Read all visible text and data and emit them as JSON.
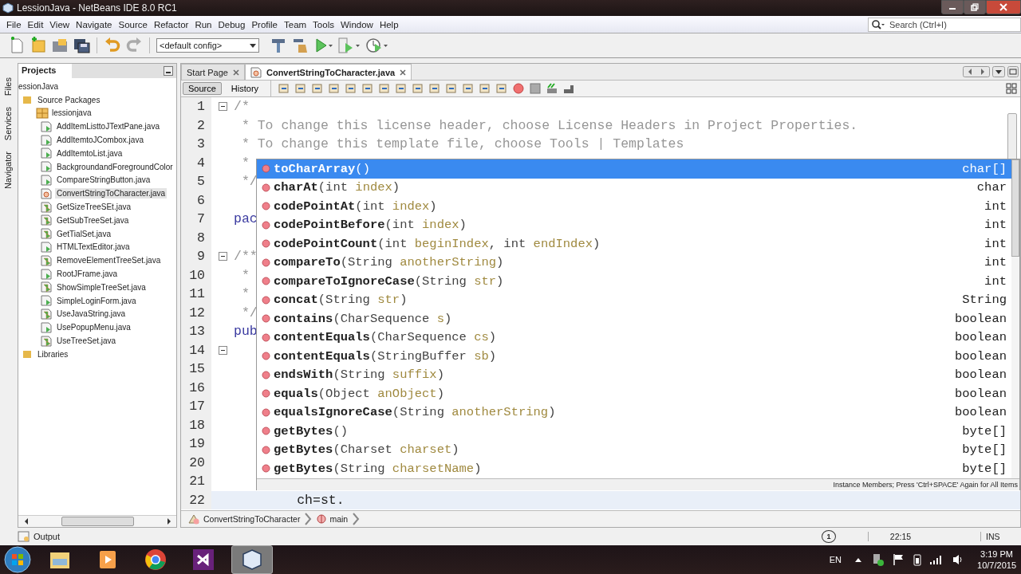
{
  "window": {
    "title": "LessionJava - NetBeans IDE 8.0 RC1"
  },
  "menu": [
    "File",
    "Edit",
    "View",
    "Navigate",
    "Source",
    "Refactor",
    "Run",
    "Debug",
    "Profile",
    "Team",
    "Tools",
    "Window",
    "Help"
  ],
  "toolbar": {
    "config": "<default config>"
  },
  "search": {
    "placeholder": "Search (Ctrl+I)"
  },
  "side_tabs": [
    "Files",
    "Services",
    "Navigator"
  ],
  "projects": {
    "title": "Projects",
    "tree": [
      {
        "label": "essionJava",
        "children": [
          {
            "label": "Source Packages",
            "kind": "folder",
            "children": [
              {
                "label": "lessionjava",
                "kind": "package",
                "children": [
                  {
                    "label": "AddItemListtoJTextPane.java",
                    "kind": "form",
                    "selected": false
                  },
                  {
                    "label": "AddItemtoJCombox.java",
                    "kind": "form",
                    "selected": false
                  },
                  {
                    "label": "AddItemtoList.java",
                    "kind": "form",
                    "selected": false
                  },
                  {
                    "label": "BackgroundandForegroundColor",
                    "kind": "form",
                    "selected": false
                  },
                  {
                    "label": "CompareStringButton.java",
                    "kind": "form",
                    "selected": false
                  },
                  {
                    "label": "ConvertStringToCharacter.java",
                    "kind": "class",
                    "selected": true
                  },
                  {
                    "label": "GetSizeTreeSEt.java",
                    "kind": "main",
                    "selected": false
                  },
                  {
                    "label": "GetSubTreeSet.java",
                    "kind": "main",
                    "selected": false
                  },
                  {
                    "label": "GetTialSet.java",
                    "kind": "main",
                    "selected": false
                  },
                  {
                    "label": "HTMLTextEditor.java",
                    "kind": "form",
                    "selected": false
                  },
                  {
                    "label": "RemoveElementTreeSet.java",
                    "kind": "main",
                    "selected": false
                  },
                  {
                    "label": "RootJFrame.java",
                    "kind": "form",
                    "selected": false
                  },
                  {
                    "label": "ShowSimpleTreeSet.java",
                    "kind": "main",
                    "selected": false
                  },
                  {
                    "label": "SimpleLoginForm.java",
                    "kind": "form",
                    "selected": false
                  },
                  {
                    "label": "UseJavaString.java",
                    "kind": "main",
                    "selected": false
                  },
                  {
                    "label": "UsePopupMenu.java",
                    "kind": "form",
                    "selected": false
                  },
                  {
                    "label": "UseTreeSet.java",
                    "kind": "main",
                    "selected": false
                  }
                ]
              }
            ]
          },
          {
            "label": "Libraries",
            "kind": "folder"
          }
        ]
      }
    ]
  },
  "editor_tabs": [
    {
      "label": "Start Page",
      "selected": false
    },
    {
      "label": "ConvertStringToCharacter.java",
      "selected": true
    }
  ],
  "views": [
    {
      "label": "Source",
      "selected": true
    },
    {
      "label": "History",
      "selected": false
    }
  ],
  "code": [
    {
      "number": "1",
      "text": "/*",
      "kind": "comment",
      "fold": true,
      "current": false
    },
    {
      "number": "2",
      "text": " * To change this license header, choose License Headers in Project Properties.",
      "kind": "comment",
      "fold": false,
      "current": false
    },
    {
      "number": "3",
      "text": " * To change this template file, choose Tools | Templates",
      "kind": "comment",
      "fold": false,
      "current": false
    },
    {
      "number": "4",
      "text": " *",
      "kind": "comment",
      "fold": false,
      "current": false
    },
    {
      "number": "5",
      "text": " */",
      "kind": "comment",
      "fold": false,
      "current": false
    },
    {
      "number": "6",
      "fold": false,
      "current": false
    },
    {
      "number": "7",
      "text": "pac",
      "kind": "keyword",
      "fold": false,
      "current": false
    },
    {
      "number": "8",
      "fold": false,
      "current": false
    },
    {
      "number": "9",
      "text": "/**",
      "kind": "comment",
      "fold": true,
      "current": false
    },
    {
      "number": "10",
      "text": " *",
      "kind": "comment",
      "fold": false,
      "current": false
    },
    {
      "number": "11",
      "text": " *",
      "kind": "comment",
      "fold": false,
      "current": false
    },
    {
      "number": "12",
      "text": " */",
      "kind": "comment",
      "fold": false,
      "current": false
    },
    {
      "number": "13",
      "text": "pub",
      "kind": "keyword",
      "fold": false,
      "current": false
    },
    {
      "number": "14",
      "fold": true,
      "current": false
    },
    {
      "number": "15",
      "fold": false,
      "current": false
    },
    {
      "number": "16",
      "fold": false,
      "current": false
    },
    {
      "number": "17",
      "fold": false,
      "current": false
    },
    {
      "number": "18",
      "fold": false,
      "current": false
    },
    {
      "number": "19",
      "fold": false,
      "current": false
    },
    {
      "number": "20",
      "fold": false,
      "current": false
    },
    {
      "number": "21",
      "fold": false,
      "current": false
    },
    {
      "number": "22",
      "text": "        ch=st.",
      "kind": "code",
      "fold": false,
      "current": true
    }
  ],
  "completion": {
    "items": [
      {
        "name": "toCharArray",
        "args": [
          {
            "text": "()",
            "kind": "type"
          }
        ],
        "returns": "char[]",
        "selected": true
      },
      {
        "name": "charAt",
        "args": [
          {
            "text": "(int ",
            "kind": "type"
          },
          {
            "text": "index",
            "kind": "param"
          },
          {
            "text": ")",
            "kind": "type"
          }
        ],
        "returns": "char",
        "selected": false
      },
      {
        "name": "codePointAt",
        "args": [
          {
            "text": "(int ",
            "kind": "type"
          },
          {
            "text": "index",
            "kind": "param"
          },
          {
            "text": ")",
            "kind": "type"
          }
        ],
        "returns": "int",
        "selected": false
      },
      {
        "name": "codePointBefore",
        "args": [
          {
            "text": "(int ",
            "kind": "type"
          },
          {
            "text": "index",
            "kind": "param"
          },
          {
            "text": ")",
            "kind": "type"
          }
        ],
        "returns": "int",
        "selected": false
      },
      {
        "name": "codePointCount",
        "args": [
          {
            "text": "(int ",
            "kind": "type"
          },
          {
            "text": "beginIndex",
            "kind": "param"
          },
          {
            "text": ", int ",
            "kind": "type"
          },
          {
            "text": "endIndex",
            "kind": "param"
          },
          {
            "text": ")",
            "kind": "type"
          }
        ],
        "returns": "int",
        "selected": false
      },
      {
        "name": "compareTo",
        "args": [
          {
            "text": "(String ",
            "kind": "type"
          },
          {
            "text": "anotherString",
            "kind": "param"
          },
          {
            "text": ")",
            "kind": "type"
          }
        ],
        "returns": "int",
        "selected": false
      },
      {
        "name": "compareToIgnoreCase",
        "args": [
          {
            "text": "(String ",
            "kind": "type"
          },
          {
            "text": "str",
            "kind": "param"
          },
          {
            "text": ")",
            "kind": "type"
          }
        ],
        "returns": "int",
        "selected": false
      },
      {
        "name": "concat",
        "args": [
          {
            "text": "(String ",
            "kind": "type"
          },
          {
            "text": "str",
            "kind": "param"
          },
          {
            "text": ")",
            "kind": "type"
          }
        ],
        "returns": "String",
        "selected": false
      },
      {
        "name": "contains",
        "args": [
          {
            "text": "(CharSequence ",
            "kind": "type"
          },
          {
            "text": "s",
            "kind": "param"
          },
          {
            "text": ")",
            "kind": "type"
          }
        ],
        "returns": "boolean",
        "selected": false
      },
      {
        "name": "contentEquals",
        "args": [
          {
            "text": "(CharSequence ",
            "kind": "type"
          },
          {
            "text": "cs",
            "kind": "param"
          },
          {
            "text": ")",
            "kind": "type"
          }
        ],
        "returns": "boolean",
        "selected": false
      },
      {
        "name": "contentEquals",
        "args": [
          {
            "text": "(StringBuffer ",
            "kind": "type"
          },
          {
            "text": "sb",
            "kind": "param"
          },
          {
            "text": ")",
            "kind": "type"
          }
        ],
        "returns": "boolean",
        "selected": false
      },
      {
        "name": "endsWith",
        "args": [
          {
            "text": "(String ",
            "kind": "type"
          },
          {
            "text": "suffix",
            "kind": "param"
          },
          {
            "text": ")",
            "kind": "type"
          }
        ],
        "returns": "boolean",
        "selected": false
      },
      {
        "name": "equals",
        "args": [
          {
            "text": "(Object ",
            "kind": "type"
          },
          {
            "text": "anObject",
            "kind": "param"
          },
          {
            "text": ")",
            "kind": "type"
          }
        ],
        "returns": "boolean",
        "selected": false
      },
      {
        "name": "equalsIgnoreCase",
        "args": [
          {
            "text": "(String ",
            "kind": "type"
          },
          {
            "text": "anotherString",
            "kind": "param"
          },
          {
            "text": ")",
            "kind": "type"
          }
        ],
        "returns": "boolean",
        "selected": false
      },
      {
        "name": "getBytes",
        "args": [
          {
            "text": "()",
            "kind": "type"
          }
        ],
        "returns": "byte[]",
        "selected": false
      },
      {
        "name": "getBytes",
        "args": [
          {
            "text": "(Charset ",
            "kind": "type"
          },
          {
            "text": "charset",
            "kind": "param"
          },
          {
            "text": ")",
            "kind": "type"
          }
        ],
        "returns": "byte[]",
        "selected": false
      },
      {
        "name": "getBytes",
        "args": [
          {
            "text": "(String ",
            "kind": "type"
          },
          {
            "text": "charsetName",
            "kind": "param"
          },
          {
            "text": ")",
            "kind": "type"
          }
        ],
        "returns": "byte[]",
        "selected": false
      }
    ],
    "footer": "Instance Members; Press 'Ctrl+SPACE' Again for All Items"
  },
  "breadcrumbs": [
    "ConvertStringToCharacter",
    "main"
  ],
  "output": {
    "label": "Output"
  },
  "status_bar": {
    "notifications": "1",
    "position": "22:15",
    "mode": "INS"
  },
  "taskbar": {
    "apps": [
      {
        "kind": "folder",
        "selected": false
      },
      {
        "kind": "media",
        "selected": false
      },
      {
        "kind": "browser",
        "selected": false
      },
      {
        "kind": "studio",
        "selected": false
      },
      {
        "kind": "cube",
        "selected": true
      }
    ],
    "language": "EN",
    "time": "3:19 PM",
    "date": "10/7/2015"
  }
}
